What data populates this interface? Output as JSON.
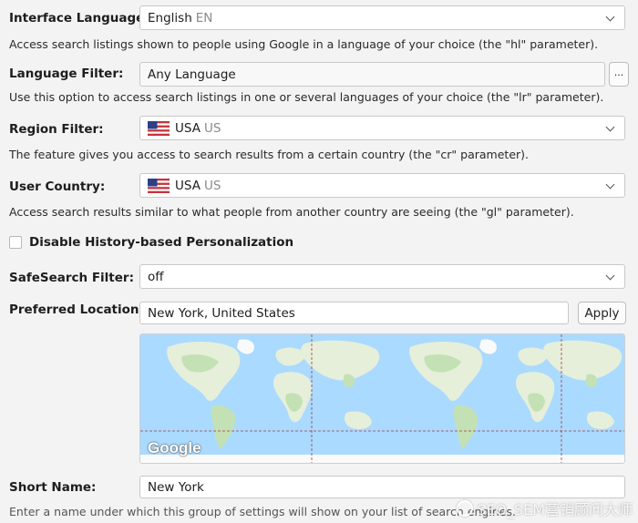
{
  "interface_language": {
    "label": "Interface Language:",
    "value": "English",
    "code": "EN",
    "description": "Access search listings shown to people using Google in a language of your choice (the \"hl\" parameter)."
  },
  "language_filter": {
    "label": "Language Filter:",
    "value": "Any Language",
    "more_button": "...",
    "description": "Use this option to access search listings in one or several languages of your choice (the \"lr\" parameter)."
  },
  "region_filter": {
    "label": "Region Filter:",
    "flag_icon": "us-flag-icon",
    "value": "USA",
    "code": "US",
    "description": "The feature gives you access to search results from a certain country (the \"cr\" parameter)."
  },
  "user_country": {
    "label": "User Country:",
    "flag_icon": "us-flag-icon",
    "value": "USA",
    "code": "US",
    "description": "Access search results similar to what people from another country are seeing (the \"gl\" parameter)."
  },
  "history_personalization": {
    "label": "Disable History-based Personalization",
    "checked": false
  },
  "safesearch": {
    "label": "SafeSearch Filter:",
    "value": "off"
  },
  "preferred_location": {
    "label": "Preferred Location:",
    "value": "New York, United States",
    "apply_button": "Apply",
    "map_logo": "Google"
  },
  "short_name": {
    "label": "Short Name:",
    "value": "New York",
    "description": "Enter a name under which this group of settings will show on your list of search engines."
  },
  "watermark": "SEO_SEM营销顾问大师",
  "colors": {
    "ocean": "#aadaff",
    "land": "#e6efd9",
    "forest": "#c3e1b4",
    "ice": "#fafafa",
    "border_line": "#a03a46"
  }
}
